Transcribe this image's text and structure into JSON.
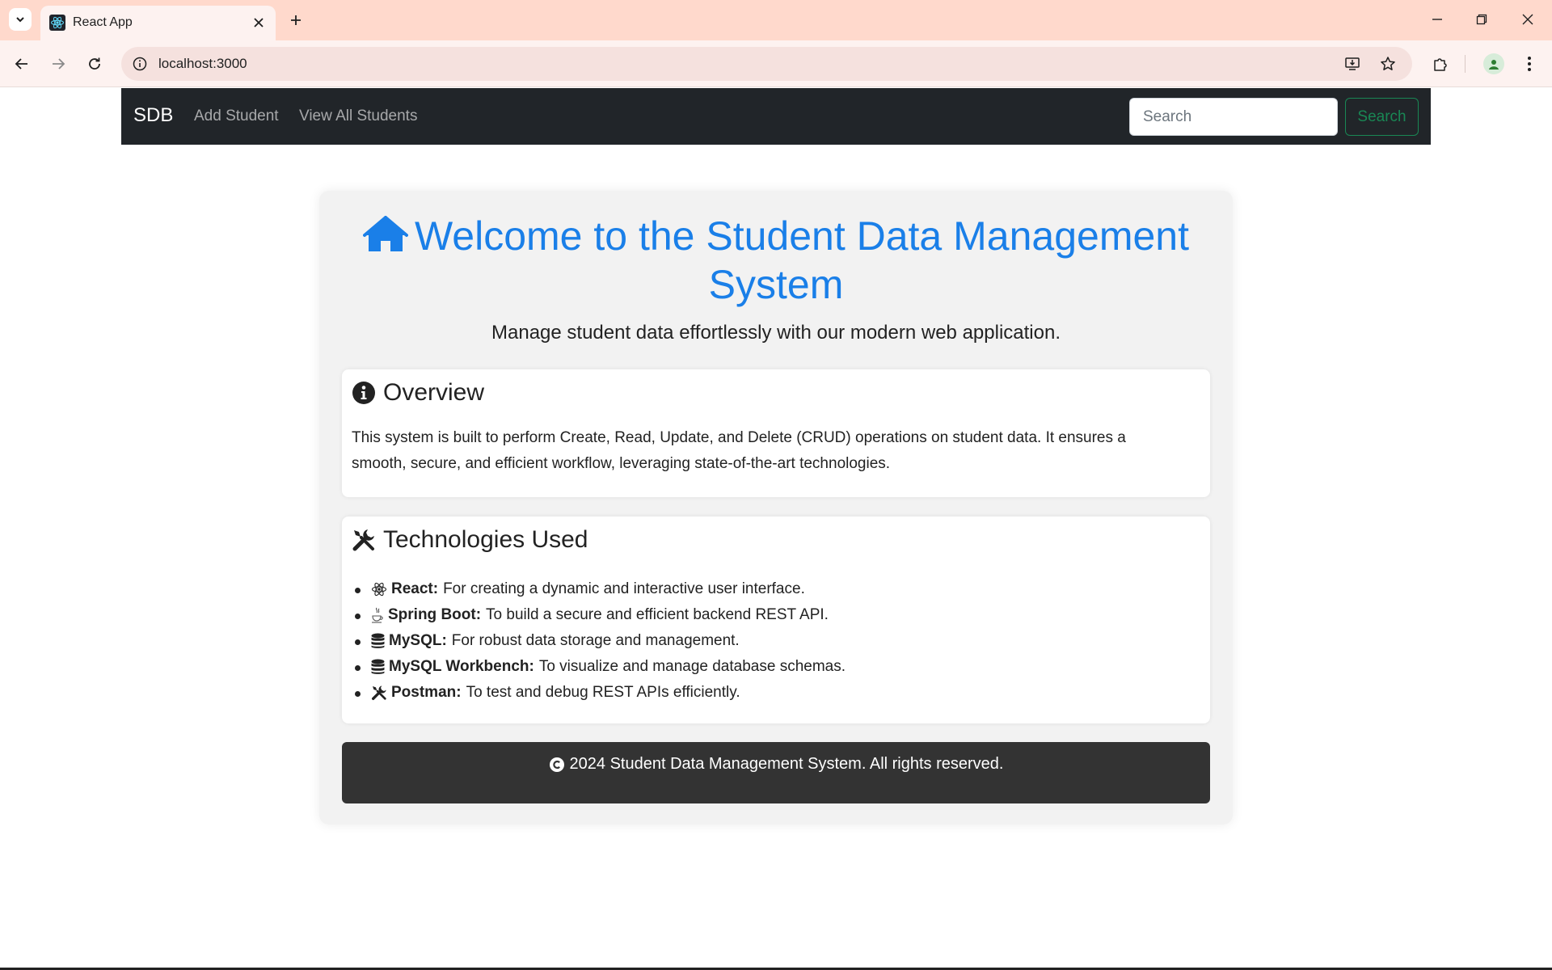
{
  "browser": {
    "tab_title": "React App",
    "url": "localhost:3000"
  },
  "navbar": {
    "brand": "SDB",
    "links": [
      "Add Student",
      "View All Students"
    ],
    "search_placeholder": "Search",
    "search_button": "Search"
  },
  "hero": {
    "title": "Welcome to the Student Data Management System",
    "subtitle": "Manage student data effortlessly with our modern web application."
  },
  "overview": {
    "title": "Overview",
    "text": "This system is built to perform Create, Read, Update, and Delete (CRUD) operations on student data. It ensures a smooth, secure, and efficient workflow, leveraging state-of-the-art technologies."
  },
  "technologies": {
    "title": "Technologies Used",
    "items": [
      {
        "icon": "react-icon",
        "name": "React:",
        "desc": "For creating a dynamic and interactive user interface."
      },
      {
        "icon": "coffee-icon",
        "name": "Spring Boot:",
        "desc": "To build a secure and efficient backend REST API."
      },
      {
        "icon": "database-icon",
        "name": "MySQL:",
        "desc": "For robust data storage and management."
      },
      {
        "icon": "database-icon",
        "name": "MySQL Workbench:",
        "desc": "To visualize and manage database schemas."
      },
      {
        "icon": "tools-icon",
        "name": "Postman:",
        "desc": "To test and debug REST APIs efficiently."
      }
    ]
  },
  "footer": {
    "text": "2024 Student Data Management System. All rights reserved."
  },
  "colors": {
    "accent": "#1a7fe8",
    "navbar_bg": "#212529",
    "search_button": "#198754",
    "footer_bg": "#333333",
    "tabbar_bg": "#ffd9cc"
  }
}
